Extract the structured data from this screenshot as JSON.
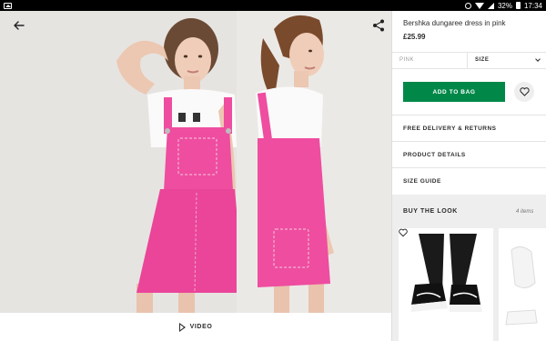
{
  "status_bar": {
    "battery": "32%",
    "time": "17:34"
  },
  "gallery": {
    "video_label": "VIDEO"
  },
  "product": {
    "title": "Bershka dungaree dress in pink",
    "price": "£25.99",
    "colour": "PINK",
    "size_label": "SIZE",
    "add_to_bag": "ADD TO BAG"
  },
  "sections": [
    {
      "label": "FREE DELIVERY & RETURNS"
    },
    {
      "label": "PRODUCT DETAILS"
    },
    {
      "label": "SIZE GUIDE"
    }
  ],
  "buy_the_look": {
    "title": "BUY THE LOOK",
    "count": "4 items",
    "items": [
      {
        "name": "black-high-top-trainers"
      },
      {
        "name": "white-socks"
      }
    ]
  },
  "colors": {
    "accent_green": "#018849",
    "dress_pink": "#ee4da0"
  }
}
